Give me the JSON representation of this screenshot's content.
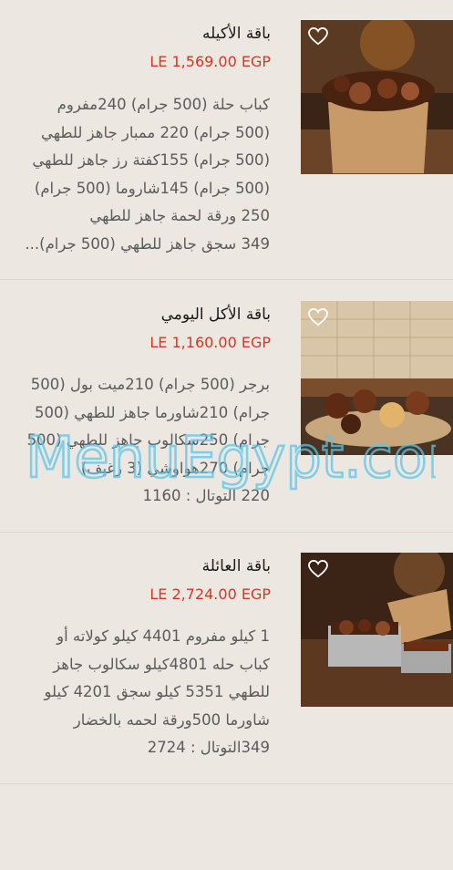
{
  "items": [
    {
      "title": "باقة الأكيله",
      "price": "LE 1,569.00 EGP",
      "description": "كباب حلة (500 جرام) 240مفروم\n(500 جرام) 220 ممبار جاهز للطهي\n(500 جرام) 155كفتة رز جاهز للطهي\n(500 جرام) 145شاروما (500 جرام)\n250 ورقة لحمة  جاهز للطهي\n349 سجق جاهز للطهي (500 جرام)..."
    },
    {
      "title": "باقة الأكل اليومي",
      "price": "LE 1,160.00 EGP",
      "description": "برجر (500 جرام) 210ميت بول (500\nجرام) 210شاورما جاهز للطهي (500\nجرام) 250سكالوب جاهز للطهي (500\nجرام) 270هواوشي (3 رغيف)\n220 التوتال : 1160"
    },
    {
      "title": "باقة العائلة",
      "price": "LE 2,724.00 EGP",
      "description": "1 كيلو مفروم 4401 كيلو كولاته أو\nكباب حله 4801كيلو سكالوب جاهز\nللطهي 5351 كيلو سجق 4201 كيلو\nشاورما 500ورقة لحمه بالخضار\n349التوتال : 2724"
    }
  ],
  "watermark": "MenuEgypt.com",
  "colors": {
    "price": "#d9361f",
    "background": "#ece8e1"
  }
}
